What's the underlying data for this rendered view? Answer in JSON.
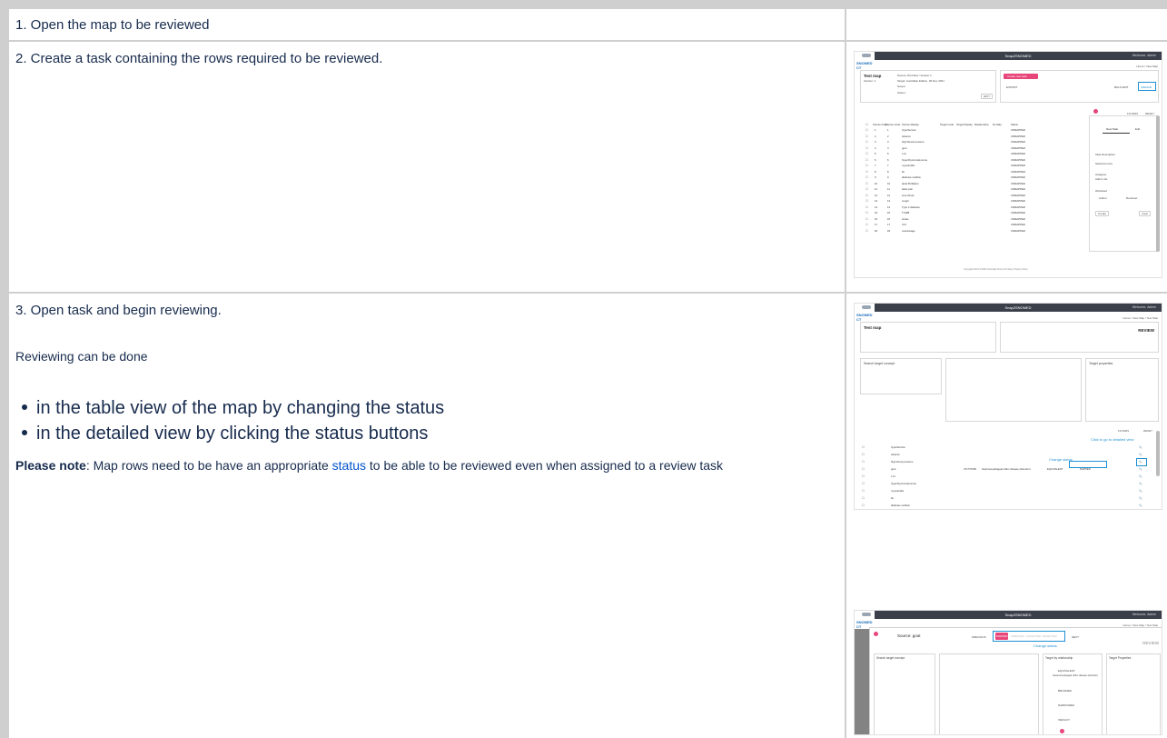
{
  "steps": {
    "step1": "1. Open the map to be reviewed",
    "step2": "2. Create a task containing the rows required to be reviewed.",
    "step3": "3. Open task and begin reviewing.",
    "reviewing_intro": "Reviewing can be done",
    "bullets": [
      "in the table view of the map by changing the status",
      "in the detailed view by clicking the status buttons"
    ],
    "note_label": "Please note",
    "note_pre": ": Map rows need to be have an appropriate ",
    "note_link": "status",
    "note_post": " to be able to be reviewed even when assigned to a review task"
  },
  "shot2": {
    "app_title": "Snap2SNOMED",
    "welcome": "Welcome, Admin",
    "crumb": "Home / View Map",
    "map_title": "Test map",
    "version": "Version: 1",
    "source": "Source: Dim/Test / Version 1",
    "target": "Target: Australian Edition, 30 Nov 2021",
    "scope": "Scope:",
    "owner": "Owner:",
    "edit": "EDIT",
    "warning": "Create new task",
    "export": "EXPORT",
    "bulk_edit": "BULK EDIT",
    "create": "CREATE",
    "filters": "FILTERS",
    "reset": "RESET",
    "cols": [
      "Source Index",
      "Source Code",
      "Source Display",
      "Target Code",
      "Target Display",
      "Relationship",
      "No Map",
      "Status",
      "Last modified",
      "Assigned author",
      "Assigned reviewer"
    ],
    "rows": [
      [
        "1",
        "1",
        "hypothermia",
        "UNMAPPED"
      ],
      [
        "2",
        "2",
        "tobacco",
        "UNMAPPED"
      ],
      [
        "3",
        "3",
        "high blood pressure",
        "UNMAPPED"
      ],
      [
        "4",
        "4",
        "gout",
        "UNMAPPED"
      ],
      [
        "5",
        "5",
        "c.tt.i",
        "UNMAPPED"
      ],
      [
        "6",
        "6",
        "hyperthyroid adenoma",
        "UNMAPPED"
      ],
      [
        "7",
        "7",
        "myocarditis",
        "UNMAPPED"
      ],
      [
        "8",
        "8",
        "flu",
        "UNMAPPED"
      ],
      [
        "9",
        "9",
        "diabetes mellitus",
        "UNMAPPED"
      ],
      [
        "10",
        "10",
        "atrial fibrillation",
        "UNMAPPED"
      ],
      [
        "11",
        "11",
        "back pain",
        "UNMAPPED"
      ],
      [
        "12",
        "12",
        "sore throat",
        "UNMAPPED"
      ],
      [
        "13",
        "13",
        "cough",
        "UNMAPPED"
      ],
      [
        "14",
        "14",
        "Type 2 diabetes",
        "UNMAPPED"
      ],
      [
        "15",
        "15",
        "TCWB",
        "UNMAPPED"
      ],
      [
        "16",
        "16",
        "stroke",
        "UNMAPPED"
      ],
      [
        "17",
        "17",
        "rCS",
        "UNMAPPED"
      ],
      [
        "18",
        "18",
        "overdosage",
        "UNMAPPED"
      ]
    ],
    "task_tab_new": "New Task",
    "task_tab_edit": "Edit",
    "task_desc": "Task Description",
    "selected_rows": "Selected rows",
    "assignee": "Assignee",
    "assignee_value": "Admin 1st",
    "workload": "Workload",
    "author": "Author",
    "reviewer": "Reviewer",
    "create_btn": "Create",
    "clear_btn": "Clear",
    "footer": "Copyright 2021 CSIRO Australia    Terms & Privacy    Privacy Policy"
  },
  "shot3": {
    "app_title": "Snap2SNOMED",
    "welcome": "Welcome, Admin",
    "crumb": "Home / View Map / Test Task",
    "map_title": "Test map",
    "review": "REVIEW",
    "search_target": "Search target concept",
    "target_props": "Target properties",
    "filters": "FILTERS",
    "reset": "RESET",
    "click_detail": "Click to go to detailed view",
    "change_status": "Change status",
    "status_value": "MAPPED",
    "rows": [
      "hypothermia",
      "tobacco",
      "high blood pressure",
      "gout",
      "c.tt.i",
      "hyperthyroid adenoma",
      "myocarditis",
      "flu",
      "diabetes mellitus"
    ],
    "target_code": "271737000",
    "target_display": "Gastroesophageal reflux disease (disorder)",
    "relationship": "EQUIVALENT"
  },
  "shot4": {
    "app_title": "Snap2SNOMED",
    "welcome": "Welcome, Admin",
    "crumb": "Home / View Map / Test Task",
    "source": "Source: gout",
    "prev": "PREVIOUS",
    "next": "NEXT",
    "statuses": [
      "MAPPED",
      "INREVIEW",
      "ACCEPTED",
      "REJECTED"
    ],
    "change_status": "Change status",
    "review": "REVIEW",
    "search_target": "Search target concept",
    "target_by_rel": "Target by relationship",
    "target_props": "Target Properties",
    "rels": [
      "EQUIVALENT",
      "BROADER",
      "NARROWER",
      "INEXACT"
    ],
    "target_display": "Gastroesophageal reflux disease (disorder)"
  },
  "colors": {
    "accent": "#e8457a",
    "link": "#0052cc",
    "highlight": "#1e90d2"
  }
}
